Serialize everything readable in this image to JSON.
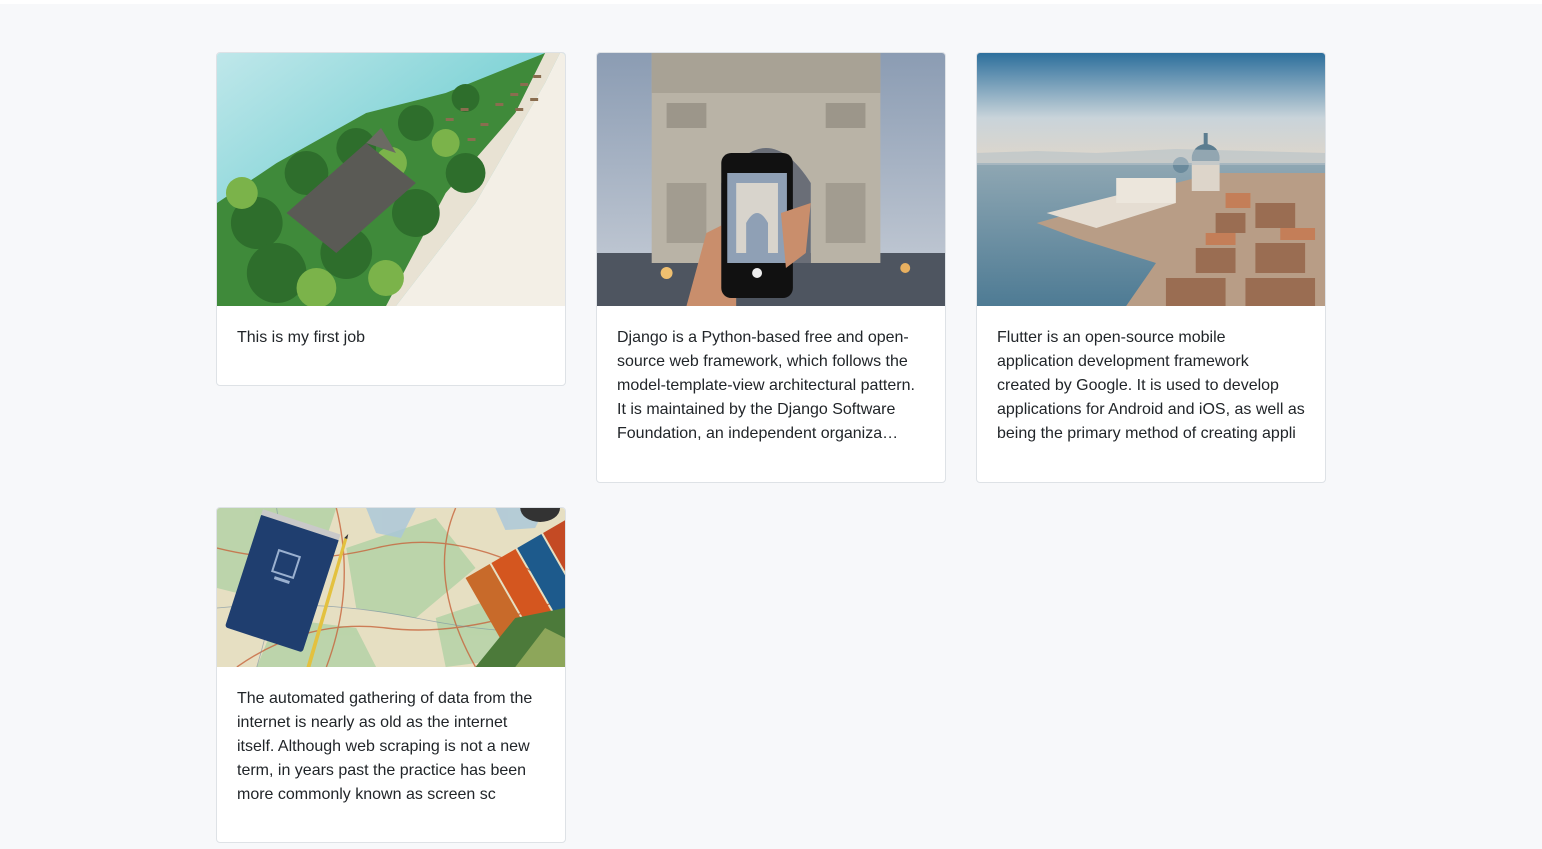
{
  "cards": [
    {
      "image_alt": "tropical beach island with palm trees",
      "text": "This is my first job"
    },
    {
      "image_alt": "phone photographing Arc de Triomphe",
      "text": "Django is a Python-based free and open-source web framework, which follows the model-template-view architectural pattern. It is maintained by the Django Software Foundation, an independent organiza…"
    },
    {
      "image_alt": "aerial view of Venice",
      "text": "Flutter is an open-source mobile application development framework created by Google. It is used to develop applications for Android and iOS, as well as being the primary method of creating appli"
    },
    {
      "image_alt": "notebook and pencil on travel maps",
      "text": "The automated gathering of data from the internet is nearly as old as the internet itself. Although web scraping is not a new term, in years past the practice has been more commonly known as screen sc"
    }
  ]
}
